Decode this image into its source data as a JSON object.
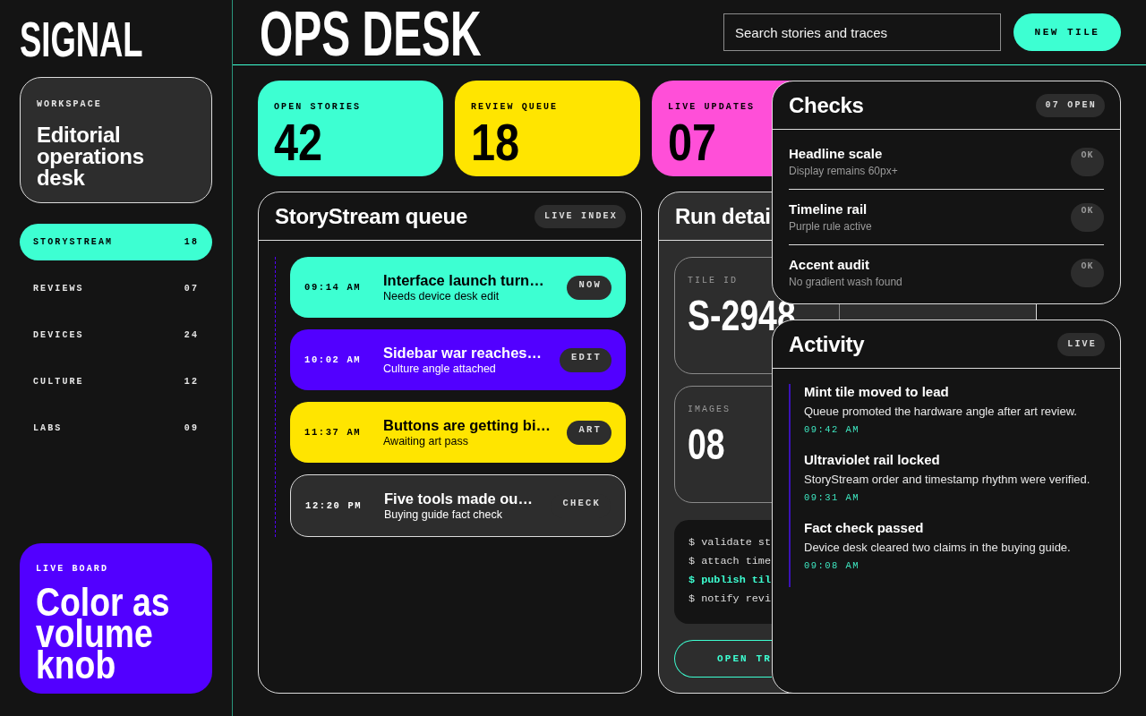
{
  "sidebar": {
    "logo": "SIGNAL",
    "workspace": {
      "label": "WORKSPACE",
      "title": "Editorial operations desk"
    },
    "nav": [
      {
        "label": "STORYSTREAM",
        "count": "18",
        "selected": true
      },
      {
        "label": "REVIEWS",
        "count": "07",
        "selected": false
      },
      {
        "label": "DEVICES",
        "count": "24",
        "selected": false
      },
      {
        "label": "CULTURE",
        "count": "12",
        "selected": false
      },
      {
        "label": "LABS",
        "count": "09",
        "selected": false
      }
    ],
    "live_board": {
      "label": "LIVE BOARD",
      "headline": "Color as volume knob"
    }
  },
  "header": {
    "title": "OPS DESK",
    "search": {
      "placeholder": "Search stories and traces"
    },
    "button": "NEW TILE"
  },
  "stats": [
    {
      "label": "OPEN STORIES",
      "value": "42",
      "color": "#3dffd2"
    },
    {
      "label": "REVIEW QUEUE",
      "value": "18",
      "color": "#ffe500"
    },
    {
      "label": "LIVE UPDATES",
      "value": "07",
      "color": "#ff4fd8"
    }
  ],
  "queue": {
    "title": "StoryStream queue",
    "badge": "LIVE INDEX",
    "items": [
      {
        "time": "09:14 AM",
        "title": "Interface launch turn…",
        "subtitle": "Needs device desk edit",
        "tag": "NOW",
        "color": "#3dffd2"
      },
      {
        "time": "10:02 AM",
        "title": "Sidebar war reaches…",
        "subtitle": "Culture angle attached",
        "tag": "EDIT",
        "color": "#5200ff"
      },
      {
        "time": "11:37 AM",
        "title": "Buttons are getting bi…",
        "subtitle": "Awaiting art pass",
        "tag": "ART",
        "color": "#ffe500"
      },
      {
        "time": "12:20 PM",
        "title": "Five tools made ou…",
        "subtitle": "Buying guide fact check",
        "tag": "CHECK",
        "color": "#2d2d2d"
      }
    ]
  },
  "run_details": {
    "title": "Run detai",
    "tiles": [
      {
        "label": "TILE ID",
        "value": "S-2948"
      },
      {
        "label": "IMAGES",
        "value": "08"
      }
    ],
    "terminal": [
      {
        "text": "$ validate st",
        "highlighted": false
      },
      {
        "text": "$ attach time",
        "highlighted": false
      },
      {
        "text": "$ publish til",
        "highlighted": true
      },
      {
        "text": "$ notify revi",
        "highlighted": false
      }
    ],
    "button": "OPEN TR"
  },
  "checks": {
    "title": "Checks",
    "badge": "07 OPEN",
    "rows": [
      {
        "title": "Headline scale",
        "detail": "Display remains 60px+",
        "status": "OK"
      },
      {
        "title": "Timeline rail",
        "detail": "Purple rule active",
        "status": "OK"
      },
      {
        "title": "Accent audit",
        "detail": "No gradient wash found",
        "status": "OK"
      }
    ]
  },
  "activity": {
    "title": "Activity",
    "badge": "LIVE",
    "items": [
      {
        "title": "Mint tile moved to lead",
        "detail": "Queue promoted the hardware angle after art review.",
        "time": "09:42 AM"
      },
      {
        "title": "Ultraviolet rail locked",
        "detail": "StoryStream order and timestamp rhythm were verified.",
        "time": "09:31 AM"
      },
      {
        "title": "Fact check passed",
        "detail": "Device desk cleared two claims in the buying guide.",
        "time": "09:08 AM"
      }
    ]
  }
}
